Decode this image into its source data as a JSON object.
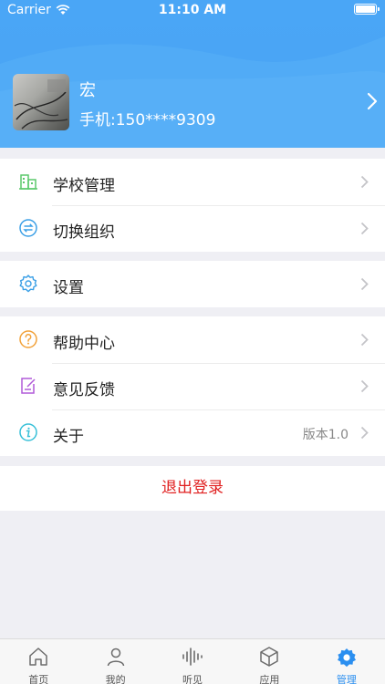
{
  "status_bar": {
    "carrier": "Carrier",
    "time": "11:10 AM"
  },
  "profile": {
    "name": "宏",
    "phone": "手机:150****9309"
  },
  "menu_groups": [
    {
      "items": [
        {
          "label": "学校管理",
          "icon": "building-icon"
        },
        {
          "label": "切换组织",
          "icon": "switch-icon"
        }
      ]
    },
    {
      "items": [
        {
          "label": "设置",
          "icon": "gear-icon"
        }
      ]
    },
    {
      "items": [
        {
          "label": "帮助中心",
          "icon": "question-icon"
        },
        {
          "label": "意见反馈",
          "icon": "feedback-icon"
        },
        {
          "label": "关于",
          "icon": "info-icon",
          "value": "版本1.0"
        }
      ]
    }
  ],
  "logout_label": "退出登录",
  "tabbar": {
    "active": "管理",
    "items": [
      {
        "label": "首页",
        "icon": "home-icon"
      },
      {
        "label": "我的",
        "icon": "person-icon"
      },
      {
        "label": "听见",
        "icon": "soundwave-icon"
      },
      {
        "label": "应用",
        "icon": "cube-icon"
      },
      {
        "label": "管理",
        "icon": "gear-icon"
      }
    ]
  },
  "colors": {
    "header_blue": "#4aa6f6",
    "tab_active": "#2b8ff0",
    "logout_red": "#e02020",
    "icon_green": "#5cc96c",
    "icon_blue": "#3a9fe6",
    "icon_orange": "#f2a23a",
    "icon_purple": "#b05ad8",
    "icon_teal": "#38c0d8"
  }
}
